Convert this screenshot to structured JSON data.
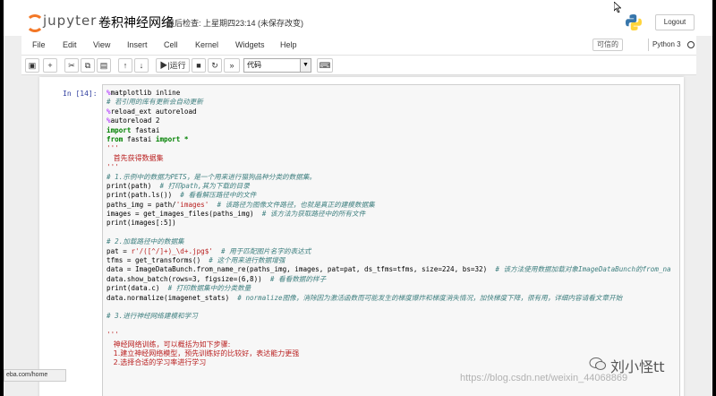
{
  "header": {
    "logo_text": "jupyter",
    "notebook_title": "卷积神经网络",
    "checkpoint": "最后检查: 上星期四23:14 (未保存改变)",
    "logout_label": "Logout"
  },
  "menu": {
    "items": [
      "File",
      "Edit",
      "View",
      "Insert",
      "Cell",
      "Kernel",
      "Widgets",
      "Help"
    ],
    "trusted_label": "可信的",
    "kernel_name": "Python 3"
  },
  "toolbar": {
    "run_label": "运行",
    "cell_type": "代码"
  },
  "cell": {
    "prompt": "In [14]:"
  },
  "code_lines": [
    "%matplotlib inline",
    "# 若引用的库有更新会自动更新",
    "%reload_ext autoreload",
    "%autoreload 2",
    "import fastai",
    "from fastai import *",
    "'''",
    "   首先获得数据集",
    "'''",
    "# 1.示例中的数据为PETS，是一个用来进行猫狗品种分类的数据集。",
    "print(path)  # 打印path,其为下载的目录",
    "print(path.ls())  # 看看解压路径中的文件",
    "paths_img = path/'images'  # 该路径为图像文件路径，也就是真正的建模数据集",
    "images = get_images_files(paths_img)  # 该方法为获取路径中的所有文件",
    "print(images[:5])",
    "",
    "# 2.加载路径中的数据集",
    "pat = r'/([^/]+)_\\d+.jpg$'  # 用于匹配图片名字的表达式",
    "tfms = get_transforms()  # 这个用来进行数据增强",
    "data = ImageDataBunch.from_name_re(paths_img, images, pat=pat, ds_tfms=tfms, size=224, bs=32)  # 该方法使用数据加载对象ImageDataBunch的from_na",
    "data.show_batch(rows=3, figsize=(6,8))  # 看看数据的样子",
    "print(data.c)  # 打印数据集中的分类数量",
    "data.normalize(imagenet_stats)  # normalize图像，消除因为激活函数而可能发生的梯度爆炸和梯度消失情况，加快梯度下降，很有用，详细内容请看文章开始",
    "",
    "# 3.进行神经网络建模和学习",
    "",
    "'''",
    "   神经网络训练，可以概括为如下步骤:",
    "   1.建立神经网络模型，预先训练好的比较好，表达能力更强",
    "   2.选择合适的学习率进行学习"
  ],
  "status": {
    "url_fragment": "eba.com/home"
  },
  "watermark": {
    "name": "刘小怪tt",
    "url": "https://blog.csdn.net/weixin_44068869"
  }
}
